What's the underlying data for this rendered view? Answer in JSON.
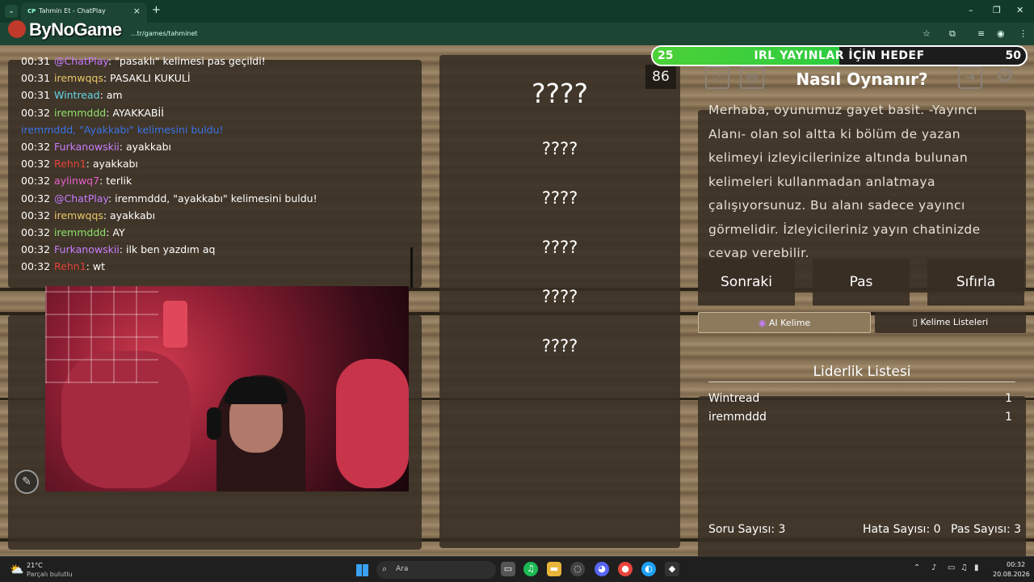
{
  "browser": {
    "tab_title": "Tahmin Et - ChatPlay",
    "tab_favicon": "CP",
    "url": "...tr/games/tahminet",
    "logo": "ByNoGame"
  },
  "goal": {
    "current": "25",
    "target": "50",
    "label": "IRL YAYINLAR İÇİN HEDEF",
    "progress_fraction": 0.5
  },
  "chat": {
    "lines": [
      {
        "time": "00:31",
        "user": "@ChatPlay",
        "color": "#c77dff",
        "text": ": \"pasaklı\" kelimesi pas geçildi!"
      },
      {
        "time": "00:31",
        "user": "iremwqqs",
        "color": "#e8c86a",
        "text": ": PASAKLI KUKULİ"
      },
      {
        "time": "00:31",
        "user": "Wintread",
        "color": "#5fd7e8",
        "text": ": am"
      },
      {
        "time": "00:32",
        "user": "iremmddd",
        "color": "#8fe36b",
        "text": ": AYAKKABİİ"
      },
      {
        "time": "",
        "user": "iremmddd, \"Ayakkabı\" kelimesini buldu!",
        "color": "#3a74e8",
        "text": ""
      },
      {
        "time": "00:32",
        "user": "Furkanowskii",
        "color": "#c77dff",
        "text": ": ayakkabı"
      },
      {
        "time": "00:32",
        "user": "Rehn1",
        "color": "#e2423a",
        "text": ": ayakkabı"
      },
      {
        "time": "00:32",
        "user": "aylinwq7",
        "color": "#e85fcf",
        "text": ": terlik"
      },
      {
        "time": "00:32",
        "user": "@ChatPlay",
        "color": "#c77dff",
        "text": ": iremmddd, \"ayakkabı\" kelimesini buldu!"
      },
      {
        "time": "00:32",
        "user": "iremwqqs",
        "color": "#e8c86a",
        "text": ": ayakkabı"
      },
      {
        "time": "00:32",
        "user": "iremmddd",
        "color": "#8fe36b",
        "text": ": AY"
      },
      {
        "time": "00:32",
        "user": "Furkanowskii",
        "color": "#c77dff",
        "text": ": ilk ben yazdım aq"
      },
      {
        "time": "00:32",
        "user": "Rehn1",
        "color": "#e2423a",
        "text": ": wt"
      }
    ]
  },
  "words": {
    "main": "????",
    "hidden": [
      "????",
      "????",
      "????",
      "????",
      "????"
    ]
  },
  "timer": "86",
  "howto": {
    "title": "Nasıl Oynanır?",
    "body": "Merhaba, oyunumuz gayet basit. -Yayıncı Alanı- olan sol altta ki bölüm de yazan kelimeyi izleyicilerinize altında bulunan kelimeleri kullanmadan anlatmaya çalışıyorsunuz. Bu alanı sadece yayıncı görmelidir. İzleyicileriniz yayın chatinizde cevap verebilir."
  },
  "buttons": {
    "next": "Sonraki",
    "pass": "Pas",
    "reset": "Sıfırla",
    "ai_word": "AI Kelime",
    "word_lists": "Kelime Listeleri"
  },
  "leaderboard": {
    "title": "Liderlik Listesi",
    "rows": [
      {
        "name": "Wintread",
        "score": "1"
      },
      {
        "name": "iremmddd",
        "score": "1"
      }
    ]
  },
  "stats": {
    "questions": "Soru Sayısı: 3",
    "errors": "Hata Sayısı: 0",
    "passes": "Pas Sayısı: 3"
  },
  "taskbar": {
    "temp": "21°C",
    "weather": "Parçalı bulutlu",
    "search": "Ara",
    "time": "00:32",
    "date": "20.08.2026"
  }
}
